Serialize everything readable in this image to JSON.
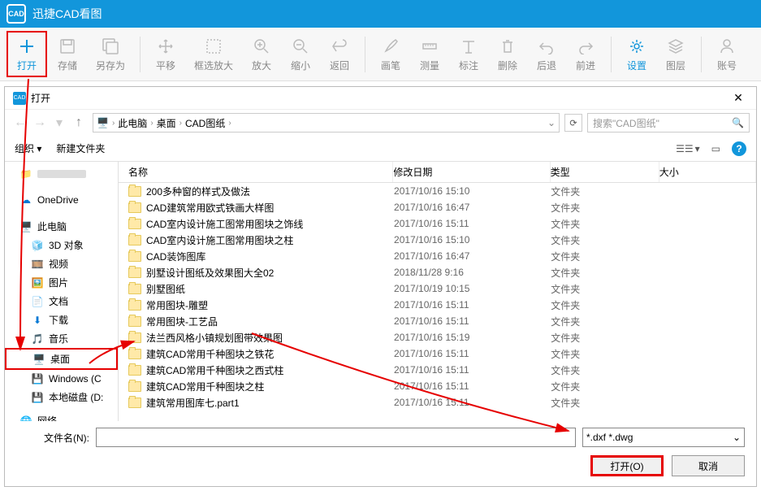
{
  "titlebar": {
    "icon_text": "CAD",
    "title": "迅捷CAD看图"
  },
  "toolbar": {
    "open": "打开",
    "save": "存储",
    "saveas": "另存为",
    "move": "平移",
    "zoombox": "框选放大",
    "zoomin": "放大",
    "zoomout": "缩小",
    "back": "返回",
    "brush": "画笔",
    "measure": "测量",
    "annotate": "标注",
    "delete": "删除",
    "undo": "后退",
    "redo": "前进",
    "settings": "设置",
    "layers": "图层",
    "account": "账号"
  },
  "dialog": {
    "title": "打开",
    "breadcrumb": [
      "此电脑",
      "桌面",
      "CAD图纸"
    ],
    "search_placeholder": "搜索\"CAD图纸\"",
    "organize": "组织",
    "newfolder": "新建文件夹",
    "columns": {
      "name": "名称",
      "date": "修改日期",
      "type": "类型",
      "size": "大小"
    },
    "sidebar": {
      "onedrive": "OneDrive",
      "thispc": "此电脑",
      "objects3d": "3D 对象",
      "videos": "视频",
      "pictures": "图片",
      "documents": "文档",
      "downloads": "下载",
      "music": "音乐",
      "desktop": "桌面",
      "windows": "Windows (C",
      "localdisk": "本地磁盘 (D:",
      "network": "网络"
    },
    "files": [
      {
        "name": "200多种窗的样式及做法",
        "date": "2017/10/16 15:10",
        "type": "文件夹"
      },
      {
        "name": "CAD建筑常用欧式铁画大样图",
        "date": "2017/10/16 16:47",
        "type": "文件夹"
      },
      {
        "name": "CAD室内设计施工图常用图块之饰线",
        "date": "2017/10/16 15:11",
        "type": "文件夹"
      },
      {
        "name": "CAD室内设计施工图常用图块之柱",
        "date": "2017/10/16 15:10",
        "type": "文件夹"
      },
      {
        "name": "CAD装饰图库",
        "date": "2017/10/16 16:47",
        "type": "文件夹"
      },
      {
        "name": "别墅设计图纸及效果图大全02",
        "date": "2018/11/28 9:16",
        "type": "文件夹"
      },
      {
        "name": "别墅图纸",
        "date": "2017/10/19 10:15",
        "type": "文件夹"
      },
      {
        "name": "常用图块-雕塑",
        "date": "2017/10/16 15:11",
        "type": "文件夹"
      },
      {
        "name": "常用图块-工艺品",
        "date": "2017/10/16 15:11",
        "type": "文件夹"
      },
      {
        "name": "法兰西风格小镇规划图带效果图",
        "date": "2017/10/16 15:19",
        "type": "文件夹"
      },
      {
        "name": "建筑CAD常用千种图块之铁花",
        "date": "2017/10/16 15:11",
        "type": "文件夹"
      },
      {
        "name": "建筑CAD常用千种图块之西式柱",
        "date": "2017/10/16 15:11",
        "type": "文件夹"
      },
      {
        "name": "建筑CAD常用千种图块之柱",
        "date": "2017/10/16 15:11",
        "type": "文件夹"
      },
      {
        "name": "建筑常用图库七.part1",
        "date": "2017/10/16 15:11",
        "type": "文件夹"
      }
    ],
    "filename_label": "文件名(N):",
    "filetype": "*.dxf *.dwg",
    "btn_open": "打开(O)",
    "btn_cancel": "取消"
  }
}
